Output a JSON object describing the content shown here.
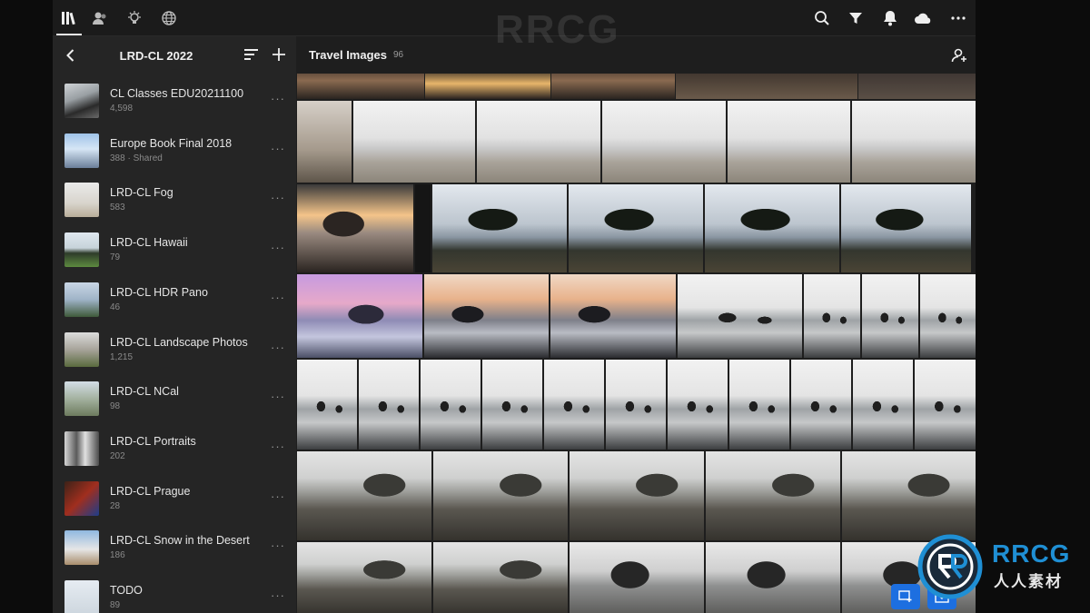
{
  "watermark": {
    "text": "RRCG"
  },
  "topbar": {
    "tabs": [
      {
        "icon": "library-icon",
        "active": true
      },
      {
        "icon": "people-icon",
        "active": false
      },
      {
        "icon": "learn-bulb-icon",
        "active": false
      },
      {
        "icon": "discover-globe-icon",
        "active": false
      }
    ],
    "actions": [
      "search-icon",
      "filter-icon",
      "notifications-bell-icon",
      "cloud-icon",
      "more-icon"
    ]
  },
  "sidebar": {
    "title": "LRD-CL 2022",
    "albums": [
      {
        "name": "CL Classes EDU20211100",
        "count": "4,598",
        "thumb": "portrait-dark"
      },
      {
        "name": "Europe Book Final 2018",
        "count": "388 · Shared",
        "thumb": "cathedral"
      },
      {
        "name": "LRD-CL Fog",
        "count": "583",
        "thumb": "fog"
      },
      {
        "name": "LRD-CL Hawaii",
        "count": "79",
        "thumb": "tree"
      },
      {
        "name": "LRD-CL HDR Pano",
        "count": "46",
        "thumb": "pano"
      },
      {
        "name": "LRD-CL Landscape Photos",
        "count": "1,215",
        "thumb": "landscape"
      },
      {
        "name": "LRD-CL NCal",
        "count": "98",
        "thumb": "ncal"
      },
      {
        "name": "LRD-CL Portraits",
        "count": "202",
        "thumb": "portraits"
      },
      {
        "name": "LRD-CL Prague",
        "count": "28",
        "thumb": "prague"
      },
      {
        "name": "LRD-CL Snow in the Desert",
        "count": "186",
        "thumb": "snow"
      },
      {
        "name": "TODO",
        "count": "89",
        "thumb": "todo"
      }
    ]
  },
  "main": {
    "title": "Travel Images",
    "count": "96"
  },
  "colors": {
    "accent": "#1d6fe0",
    "app_bg": "#1e1e1e",
    "sidebar_bg": "#252525"
  },
  "logo": {
    "line1": "RRCG",
    "line2": "人人素材"
  }
}
